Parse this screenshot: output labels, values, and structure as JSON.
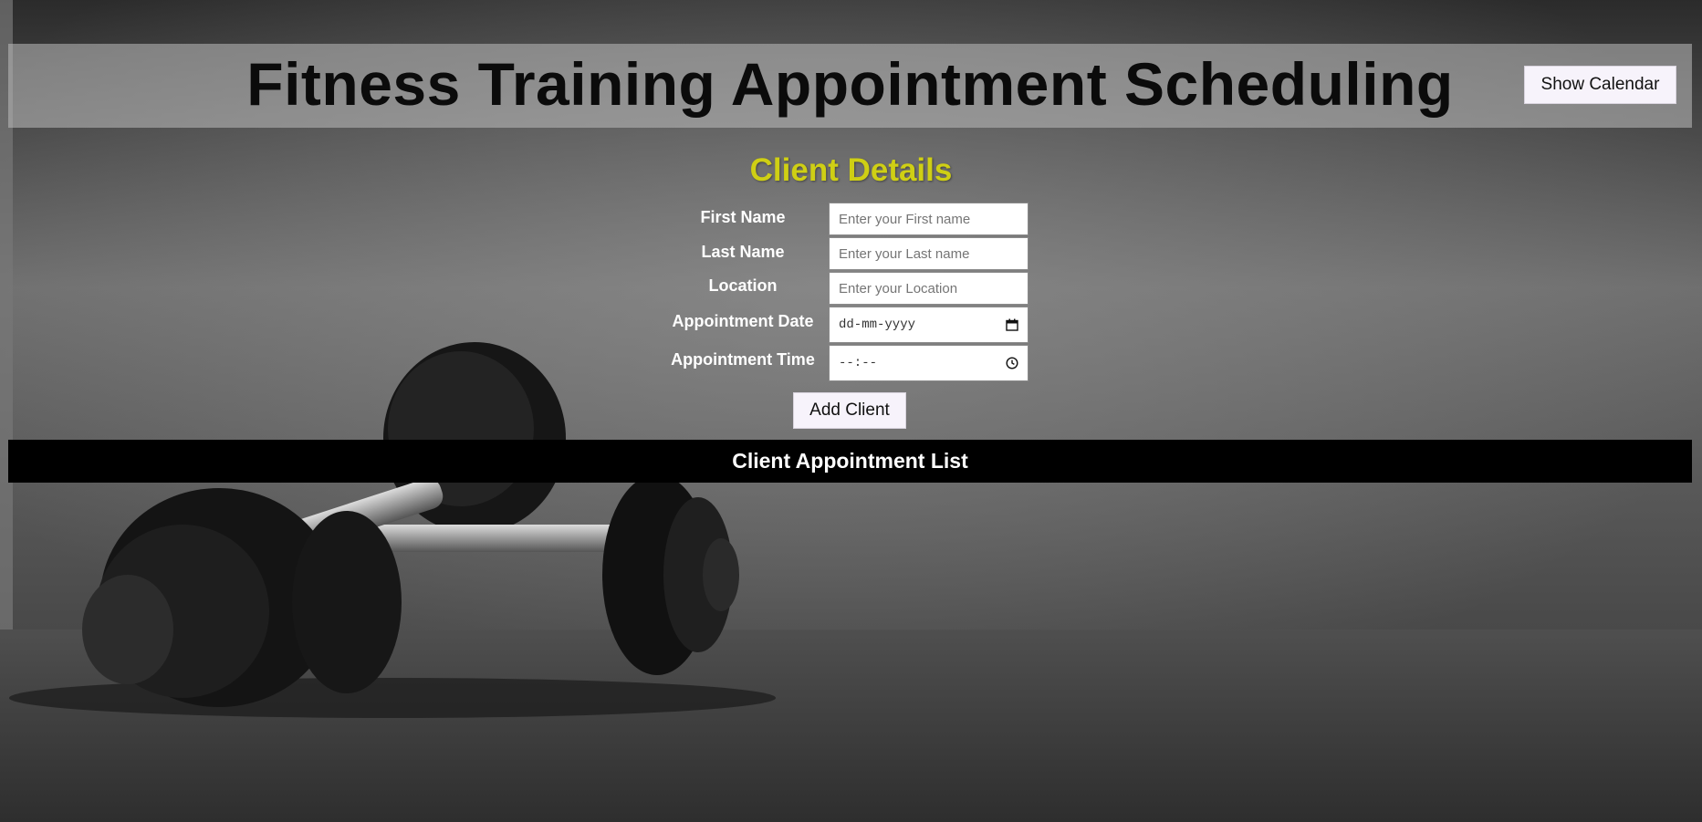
{
  "header": {
    "title": "Fitness Training Appointment Scheduling",
    "calendar_button": "Show Calendar"
  },
  "client_details": {
    "title": "Client Details",
    "fields": {
      "first_name": {
        "label": "First Name",
        "placeholder": "Enter your First name"
      },
      "last_name": {
        "label": "Last Name",
        "placeholder": "Enter your Last name"
      },
      "location": {
        "label": "Location",
        "placeholder": "Enter your Location"
      },
      "appointment_date": {
        "label": "Appointment Date",
        "placeholder": "dd-mm-yyyy",
        "icon": "calendar-icon"
      },
      "appointment_time": {
        "label": "Appointment Time",
        "placeholder": "--:--",
        "icon": "clock-icon"
      }
    },
    "add_button": "Add Client"
  },
  "appointment_list": {
    "title": "Client Appointment List"
  },
  "colors": {
    "section_title": "#cfcf14",
    "list_bar": "#000000",
    "button_bg": "#f7f3fb"
  }
}
